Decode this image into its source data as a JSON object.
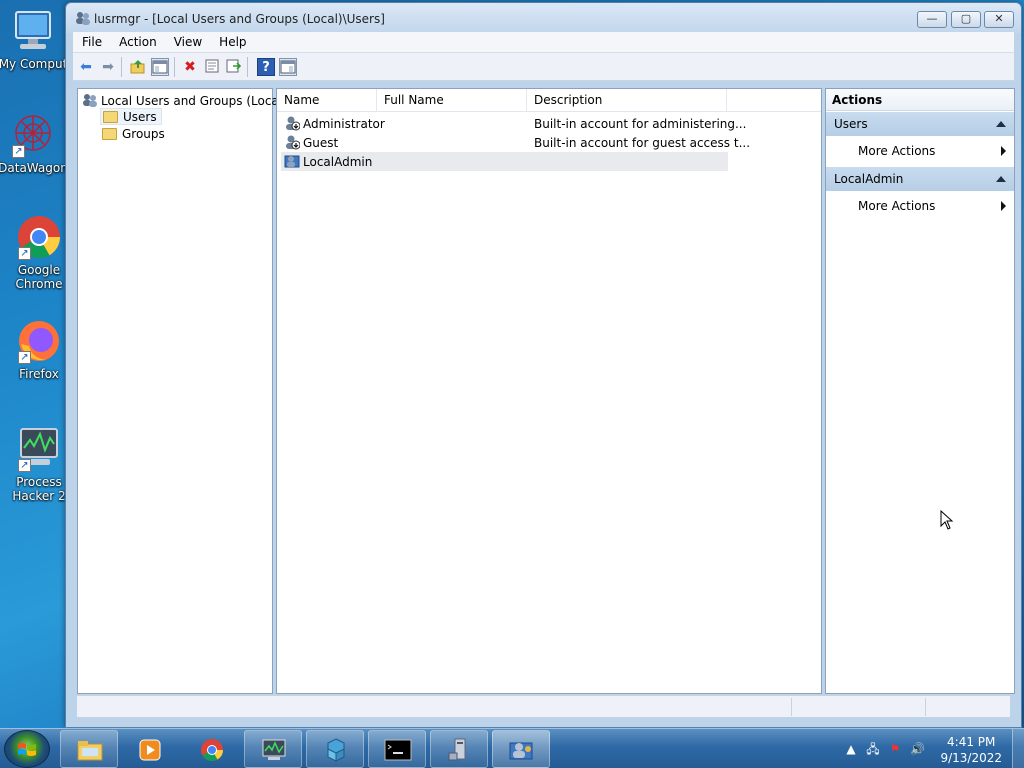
{
  "desktop": {
    "icons": [
      {
        "label": "My Comput",
        "icon": "computer-icon"
      },
      {
        "label": "DataWagon",
        "icon": "datawagon-icon"
      },
      {
        "label": "Google Chrome",
        "icon": "chrome-icon"
      },
      {
        "label": "Firefox",
        "icon": "firefox-icon"
      },
      {
        "label": "Process Hacker 2",
        "icon": "process-hacker-icon"
      }
    ]
  },
  "window": {
    "title": "lusrmgr - [Local Users and Groups (Local)\\Users]",
    "buttons": {
      "minimize": "—",
      "maximize": "▢",
      "close": "✕"
    }
  },
  "menu": {
    "file": "File",
    "action": "Action",
    "view": "View",
    "help": "Help"
  },
  "toolbar": {
    "back": "back-arrow-icon",
    "forward": "forward-arrow-icon",
    "up": "up-folder-icon",
    "show_hide_tree": "console-tree-icon",
    "delete": "delete-icon",
    "properties": "properties-icon",
    "export": "export-list-icon",
    "help": "help-icon",
    "show_hide_action": "action-pane-icon"
  },
  "tree": {
    "root": "Local Users and Groups (Local)",
    "items": [
      {
        "label": "Users",
        "selected": true
      },
      {
        "label": "Groups",
        "selected": false
      }
    ]
  },
  "list": {
    "columns": [
      "Name",
      "Full Name",
      "Description"
    ],
    "rows": [
      {
        "name": "Administrator",
        "full_name": "",
        "description": "Built-in account for administering...",
        "disabled": true
      },
      {
        "name": "Guest",
        "full_name": "",
        "description": "Built-in account for guest access t...",
        "disabled": true
      },
      {
        "name": "LocalAdmin",
        "full_name": "",
        "description": "",
        "disabled": false,
        "selected": true
      }
    ]
  },
  "actions": {
    "header": "Actions",
    "sections": [
      {
        "title": "Users",
        "items": [
          "More Actions"
        ]
      },
      {
        "title": "LocalAdmin",
        "items": [
          "More Actions"
        ]
      }
    ]
  },
  "taskbar": {
    "start": "start-orb",
    "apps": [
      "explorer-icon",
      "media-player-icon",
      "chrome-icon",
      "process-hacker-icon",
      "registry-icon",
      "cmd-icon",
      "device-manager-icon",
      "lusrmgr-icon"
    ],
    "clock": {
      "time": "4:41 PM",
      "date": "9/13/2022"
    }
  },
  "colors": {
    "accent": "#2f6aa6",
    "action_section": "#b5cde6"
  }
}
